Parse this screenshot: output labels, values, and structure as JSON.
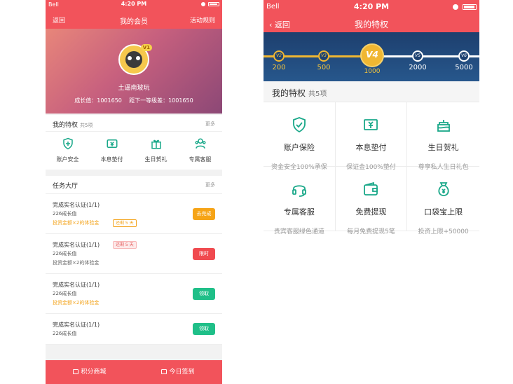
{
  "left": {
    "status": {
      "carrier": "Bell",
      "time": "4:20 PM"
    },
    "nav": {
      "back": "返回",
      "title": "我的会员",
      "right": "活动规则"
    },
    "profile": {
      "name": "土逼南玻玩",
      "vip": "V1",
      "growth": "成长值：1001650",
      "next": "距下一等级差：1001650"
    },
    "privileges": {
      "title": "我的特权",
      "count": "共5项",
      "more": "更多",
      "items": [
        {
          "label": "账户安全",
          "icon": "shield-icon"
        },
        {
          "label": "本息垫付",
          "icon": "money-icon"
        },
        {
          "label": "生日贺礼",
          "icon": "gift-icon"
        },
        {
          "label": "专属客服",
          "icon": "people-icon"
        }
      ]
    },
    "tasks": {
      "title": "任务大厅",
      "more": "更多",
      "items": [
        {
          "title": "完成实名认证(1/1)",
          "sub": "226成长值",
          "bonus": "投资金额×2的体验金",
          "tag": "还剩 5 天",
          "button": "去完成"
        },
        {
          "title": "完成实名认证(1/1)",
          "sub": "226成长值",
          "bonus": "投资金额×2的体验金",
          "tag": "还剩 5 天",
          "button": "限时"
        },
        {
          "title": "完成实名认证(1/1)",
          "sub": "226成长值",
          "bonus": "投资金额×2的体验金",
          "button": "领取"
        },
        {
          "title": "完成实名认证(1/1)",
          "sub": "226成长值",
          "button": "领取"
        }
      ]
    },
    "footer": {
      "shop": "积分商城",
      "signin": "今日签到"
    }
  },
  "right": {
    "status": {
      "carrier": "Bell",
      "time": "4:20 PM"
    },
    "nav": {
      "back": "返回",
      "title": "我的特权"
    },
    "levels": [
      {
        "label": "V2",
        "value": "200"
      },
      {
        "label": "V3",
        "value": "500"
      },
      {
        "label": "V4",
        "value": "1000"
      },
      {
        "label": "V5",
        "value": "2000"
      },
      {
        "label": "V6",
        "value": "5000"
      }
    ],
    "section": {
      "title": "我的特权",
      "count": "共5项"
    },
    "grid": [
      {
        "title": "账户保险",
        "sub": "资金安全100%承保",
        "icon": "shield-check-icon"
      },
      {
        "title": "本息垫付",
        "sub": "保证金100%垫付",
        "icon": "money-icon"
      },
      {
        "title": "生日贺礼",
        "sub": "尊享私人生日礼包",
        "icon": "cake-icon"
      },
      {
        "title": "专属客服",
        "sub": "贵宾客服绿色通道",
        "icon": "headset-icon"
      },
      {
        "title": "免费提现",
        "sub": "每月免费提现5笔",
        "icon": "wallet-icon"
      },
      {
        "title": "口袋宝上限",
        "sub": "投资上限+50000",
        "icon": "moneybag-icon"
      }
    ]
  }
}
